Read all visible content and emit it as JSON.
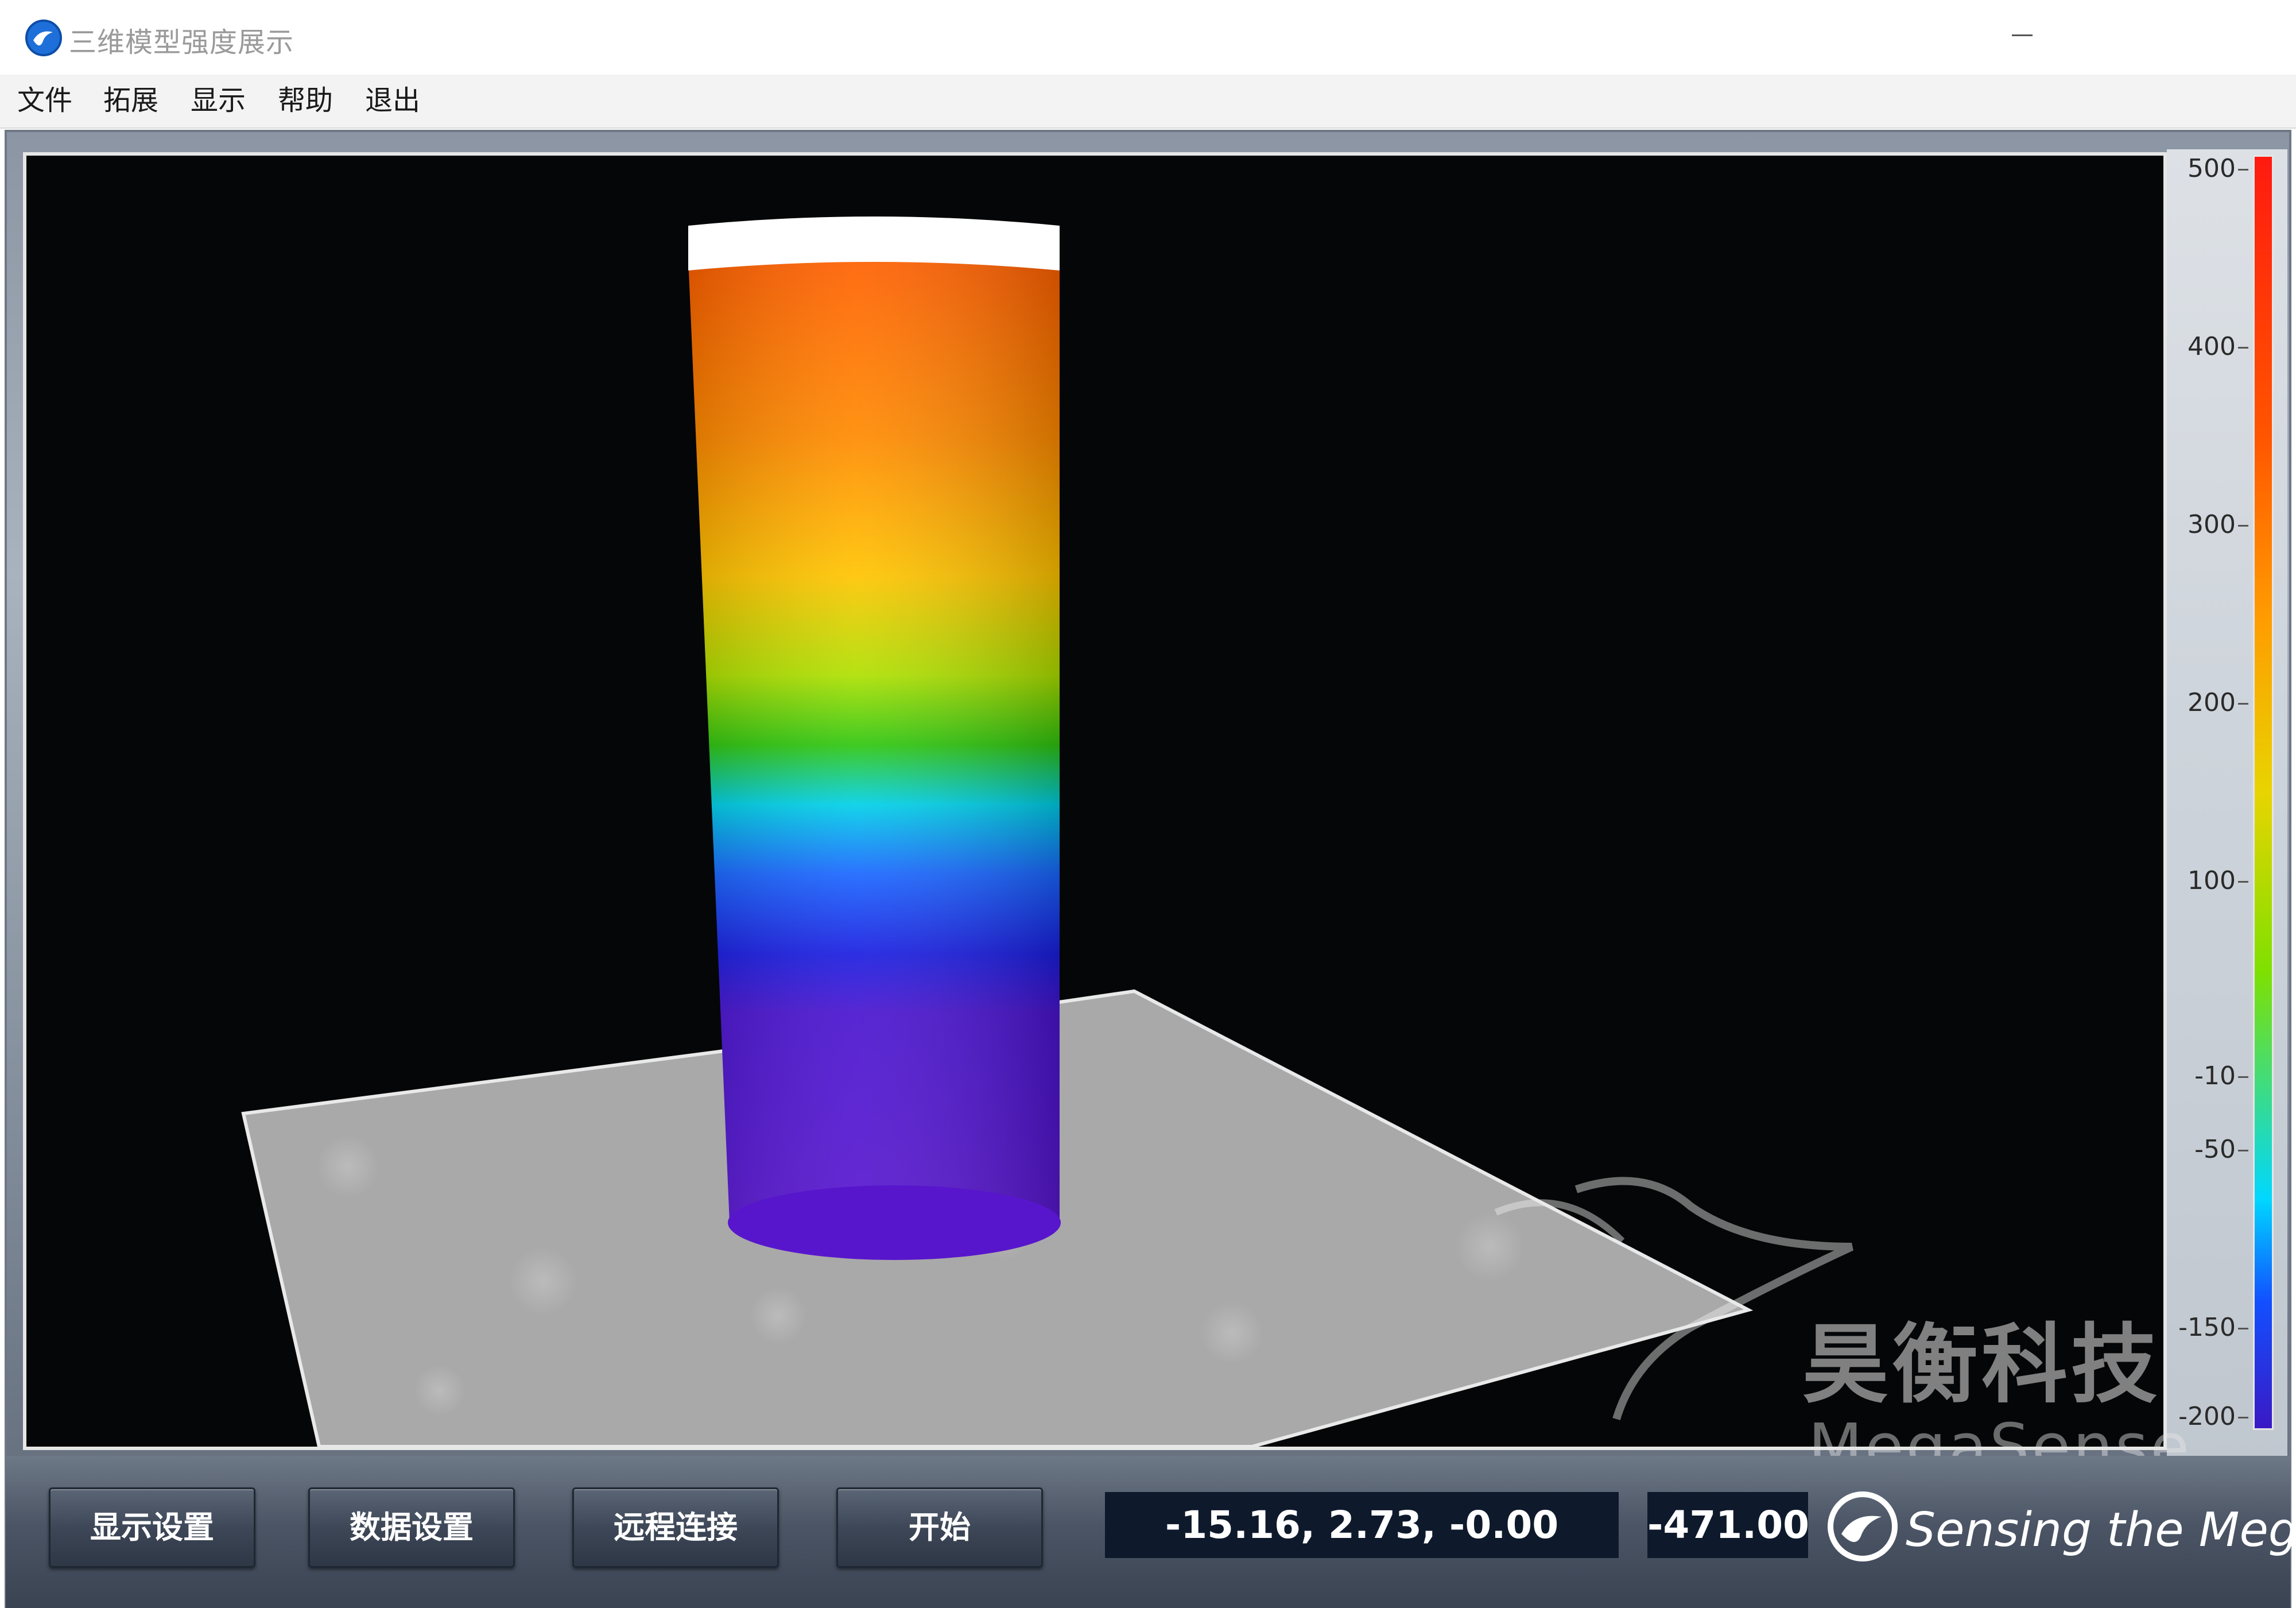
{
  "window": {
    "title": "三维模型强度展示"
  },
  "menu": {
    "items": [
      "文件",
      "拓展",
      "显示",
      "帮助",
      "退出"
    ]
  },
  "colorbar": {
    "ticks": [
      "500",
      "400",
      "300",
      "200",
      "100",
      "-10",
      "-50",
      "-150",
      "-200"
    ]
  },
  "watermark": {
    "cn": "昊衡科技",
    "en": "MegaSense"
  },
  "controls": {
    "display_settings": "显示设置",
    "data_settings": "数据设置",
    "remote_connect": "远程连接",
    "start": "开始"
  },
  "readouts": {
    "coordinates": "-15.16, 2.73, -0.00",
    "value": "-471.00"
  },
  "brand": {
    "tagline": "Sensing the Mega"
  },
  "colors": {
    "viewport_background": "#050607",
    "readout_background": "#0e1a2c",
    "button_face": "#3d4757"
  }
}
